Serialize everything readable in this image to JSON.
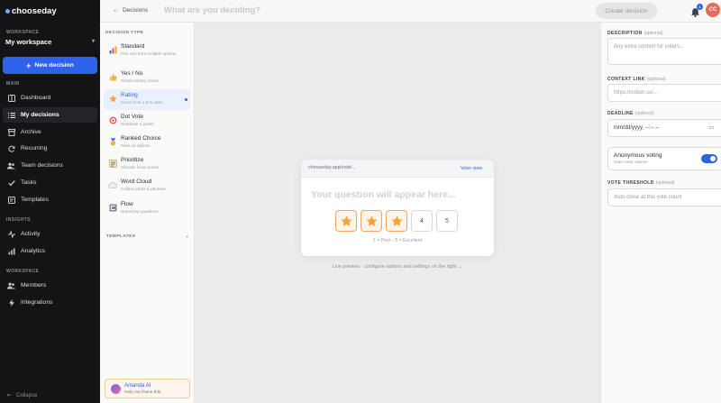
{
  "brand": {
    "name": "chooseday"
  },
  "workspace": {
    "section_label": "WORKSPACE",
    "current": "My workspace"
  },
  "new_decision": {
    "label": "New decision"
  },
  "nav": {
    "main_label": "MAIN",
    "main": [
      {
        "label": "Dashboard",
        "icon": "dashboard-icon"
      },
      {
        "label": "My decisions",
        "icon": "list-icon",
        "active": true
      },
      {
        "label": "Archive",
        "icon": "archive-icon"
      },
      {
        "label": "Recurring",
        "icon": "recurring-icon"
      },
      {
        "label": "Team decisions",
        "icon": "team-icon"
      },
      {
        "label": "Tasks",
        "icon": "tasks-icon"
      },
      {
        "label": "Templates",
        "icon": "templates-icon"
      }
    ],
    "insights_label": "INSIGHTS",
    "insights": [
      {
        "label": "Activity",
        "icon": "activity-icon"
      },
      {
        "label": "Analytics",
        "icon": "analytics-icon"
      }
    ],
    "workspace_label": "WORKSPACE",
    "workspace": [
      {
        "label": "Members",
        "icon": "members-icon"
      },
      {
        "label": "Integrations",
        "icon": "integrations-icon"
      }
    ],
    "collapse": "Collapse"
  },
  "topbar": {
    "back": "Decisions",
    "title_placeholder": "What are you deciding?",
    "create": "Create decision",
    "notification_count": "1",
    "avatar": "CC"
  },
  "decision_type": {
    "label": "DECISION TYPE",
    "items": [
      {
        "name": "Standard",
        "desc": "Pick one from multiple options",
        "icon": "bar-chart-icon"
      },
      {
        "name": "Yes / No",
        "desc": "Simple binary choice",
        "icon": "thumbs-up-icon"
      },
      {
        "name": "Rating",
        "desc": "Score from 1 to 5 stars",
        "icon": "star-icon",
        "active": true
      },
      {
        "name": "Dot Vote",
        "desc": "Distribute 5 points",
        "icon": "target-icon"
      },
      {
        "name": "Ranked Choice",
        "desc": "Rank all options",
        "icon": "medal-icon"
      },
      {
        "name": "Prioritize",
        "desc": "Allocate focus points",
        "icon": "priority-icon"
      },
      {
        "name": "Word Cloud",
        "desc": "Collect words & phrases",
        "icon": "cloud-icon"
      },
      {
        "name": "Flow",
        "desc": "Branching questions",
        "icon": "flow-icon"
      }
    ],
    "templates_label": "TEMPLATES"
  },
  "ai": {
    "name": "Amanda AI",
    "sub": "Help me frame this"
  },
  "preview": {
    "url": "chooseday.app/vote/...",
    "voter_view": "Voter view",
    "question": "Your question will appear here...",
    "rating": 3,
    "scale_max": 5,
    "cells": [
      "",
      "",
      "",
      "4",
      "5"
    ],
    "scale_text": "1 = Poor · 5 = Excellent",
    "hint": "Live preview · configure options and settings on the right →"
  },
  "settings": {
    "optional_text": "(optional)",
    "description_label": "DESCRIPTION",
    "description_placeholder": "Any extra context for voters...",
    "context_label": "CONTEXT LINK",
    "context_placeholder": "https://notion.so/...",
    "deadline_label": "DEADLINE",
    "deadline_placeholder": "mm/dd/yyyy, --:-- --",
    "anonymous_title": "Anonymous voting",
    "anonymous_sub": "Hide voter names",
    "anonymous_on": true,
    "threshold_label": "VOTE THRESHOLD",
    "threshold_placeholder": "Auto-close at this vote count"
  },
  "colors": {
    "accent": "#2f62ec",
    "star": "#f2a33a",
    "sidebar": "#141416"
  }
}
